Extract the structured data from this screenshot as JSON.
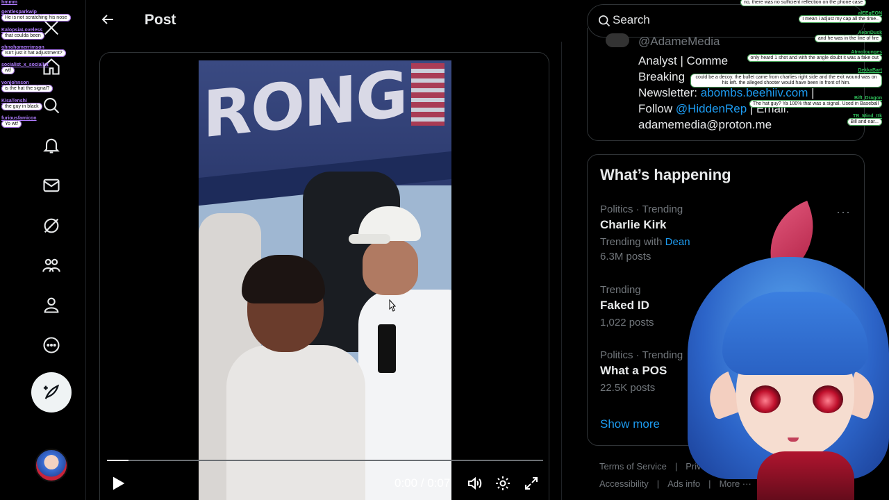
{
  "header": {
    "title": "Post"
  },
  "nav": {
    "icons": [
      "x-logo-icon",
      "home-icon",
      "search-icon",
      "bell-icon",
      "mail-icon",
      "grok-icon",
      "communities-icon",
      "profile-icon",
      "more-icon"
    ]
  },
  "video": {
    "banner_text": "RONG",
    "time": "0:00 / 0:07",
    "progress": 0.05
  },
  "search": {
    "placeholder": "Search"
  },
  "profile": {
    "handle": "@AdameMedia",
    "bio_line1": "Analyst | Comme",
    "bio_line2": "Breaking",
    "bio_line3_prefix": "Newsletter: ",
    "bio_line3_link": "abombs.beehiiv.com",
    "bio_line3_suffix": " |",
    "bio_line4_prefix": "Follow ",
    "bio_line4_link": "@HiddenRep",
    "bio_line4_suffix": " | Email:",
    "bio_line5": "adamemedia@proton.me"
  },
  "trends": {
    "title": "What’s happening",
    "items": [
      {
        "meta": "Politics · Trending",
        "name": "Charlie Kirk",
        "with_label": "Trending with",
        "with_link": "Dean",
        "count": "6.3M posts"
      },
      {
        "meta": "Trending",
        "name": "Faked ID",
        "count": "1,022 posts"
      },
      {
        "meta": "Politics · Trending",
        "name": "What a POS",
        "count": "22.5K posts"
      }
    ],
    "show_more": "Show more"
  },
  "footer": {
    "links": [
      "Terms of Service",
      "|",
      "Privacy Po",
      "Accessibility",
      "|",
      "Ads info",
      "|",
      "More ···"
    ]
  },
  "chat_left": [
    {
      "user": "hmmm",
      "msg": ""
    },
    {
      "user": "gentlesparkwip",
      "msg": "He is not scratching his nose"
    },
    {
      "user": "KalopsiaLoveless",
      "msg": "that coulda been"
    },
    {
      "user": "ohnohomerrimson",
      "msg": "Isn't just it hat adjustment?"
    },
    {
      "user": "socialist_x_socialist",
      "msg": "wtf"
    },
    {
      "user": "vonjohnson",
      "msg": "is the hat the signal?"
    },
    {
      "user": "KisaTenshi",
      "msg": "the guy in black"
    },
    {
      "user": "furiousfamicon",
      "msg": "Yo wtf"
    }
  ],
  "chat_right": [
    {
      "msg": "no, there was no sufficient reflection on the phone case"
    },
    {
      "user": "alEEgEON",
      "msg": "I mean i adjust my cap all the time.."
    },
    {
      "user": "AeonDusk",
      "msg": "and he was in the line of fire"
    },
    {
      "user": "Atmolounges",
      "msg": "only heard 1 shot and with the angle doubt it was a fake out"
    },
    {
      "user": "DekkaBart",
      "msg": "could be a decoy. the bullet came from charlies right side and the exit wound was on his left. the alleged shooter would have been in front of him."
    },
    {
      "user": "Bift_Dragon",
      "msg": "The hat guy? Ya 100% that was a signal. Used in Baseball"
    },
    {
      "user": "TB_Mind_ttk",
      "msg": "Bill and ear..."
    }
  ]
}
